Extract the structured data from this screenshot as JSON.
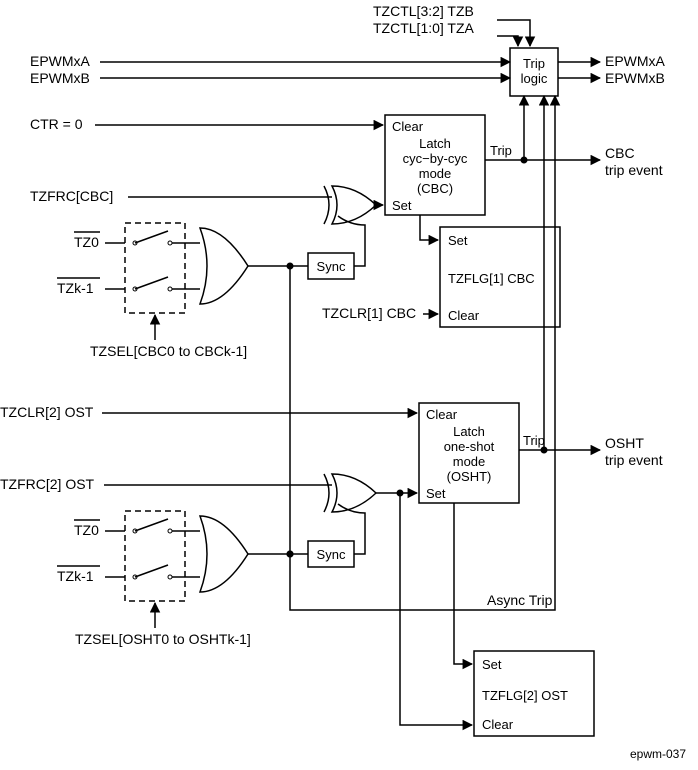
{
  "top": {
    "tzctl_b": "TZCTL[3:2] TZB",
    "tzctl_a": "TZCTL[1:0] TZA"
  },
  "io": {
    "epwmxa_in": "EPWMxA",
    "epwmxb_in": "EPWMxB",
    "epwmxa_out": "EPWMxA",
    "epwmxb_out": "EPWMxB"
  },
  "triplogic": {
    "l1": "Trip",
    "l2": "logic"
  },
  "cbc": {
    "ctr0": "CTR = 0",
    "tzfrc": "TZFRC[CBC]",
    "tz0": "TZ0",
    "tzk": "TZk-1",
    "tzsel": "TZSEL[CBC0 to CBCk-1]",
    "clear": "Clear",
    "latch1": "Latch",
    "latch2": "cyc−by-cyc",
    "latch3": "mode",
    "latch4": "(CBC)",
    "set": "Set",
    "trip": "Trip",
    "sync": "Sync",
    "flg_set": "Set",
    "flg_name": "TZFLG[1] CBC",
    "flg_clear": "Clear",
    "tzclr": "TZCLR[1] CBC",
    "event1": "CBC",
    "event2": "trip event"
  },
  "osht": {
    "tzclr": "TZCLR[2] OST",
    "tzfrc": "TZFRC[2] OST",
    "tz0": "TZ0",
    "tzk": "TZk-1",
    "tzsel": "TZSEL[OSHT0 to OSHTk-1]",
    "clear": "Clear",
    "latch1": "Latch",
    "latch2": "one-shot",
    "latch3": "mode",
    "latch4": "(OSHT)",
    "set": "Set",
    "trip": "Trip",
    "sync": "Sync",
    "flg_set": "Set",
    "flg_name": "TZFLG[2] OST",
    "flg_clear": "Clear",
    "event1": "OSHT",
    "event2": "trip event",
    "async": "Async Trip"
  },
  "ref": "epwm-037"
}
